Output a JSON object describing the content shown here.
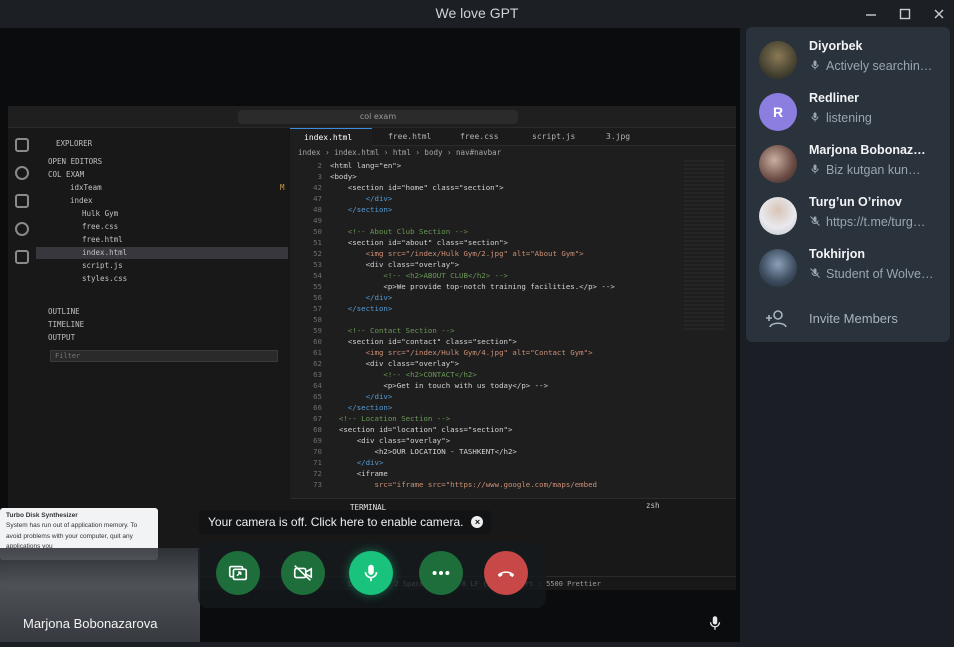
{
  "window": {
    "title": "We love GPT"
  },
  "notice": {
    "camera_off": "Your camera is off. Click here to enable camera."
  },
  "speaker": {
    "name": "Marjona Bobonazarova"
  },
  "controls": [
    {
      "name": "screen-share-button",
      "icon": "screen-share-icon",
      "color": "#1f7a3a"
    },
    {
      "name": "camera-toggle-button",
      "icon": "camera-off-icon",
      "color": "#1f7a3a"
    },
    {
      "name": "microphone-button",
      "icon": "microphone-icon",
      "color": "#19c37d"
    },
    {
      "name": "more-button",
      "icon": "more-icon",
      "color": "#1f7a3a"
    },
    {
      "name": "end-call-button",
      "icon": "phone-hangup-icon",
      "color": "#c84848"
    }
  ],
  "members": [
    {
      "name": "Diyorbek",
      "status": "Actively searchin…",
      "mic": "on"
    },
    {
      "name": "Redliner",
      "status": "listening",
      "mic": "on",
      "initial": "R",
      "avatar_color": "#8c7ee0"
    },
    {
      "name": "Marjona Bobonaz…",
      "status": "Biz kutgan kun…",
      "mic": "on"
    },
    {
      "name": "Turg’un O’rinov",
      "status": "https://t.me/turg…",
      "mic": "off"
    },
    {
      "name": "Tokhirjon",
      "status": "Student of Wolve…",
      "mic": "off"
    }
  ],
  "invite": {
    "label": "Invite Members"
  },
  "shared_screen": {
    "search": "col exam",
    "explorer_title": "EXPLORER",
    "sections": {
      "open_editors": "OPEN EDITORS",
      "project": "COL EXAM",
      "outline": "OUTLINE",
      "timeline": "TIMELINE",
      "output": "OUTPUT"
    },
    "tree": [
      {
        "label": "idxTeam",
        "mark": "M"
      },
      {
        "label": "index"
      },
      {
        "label": "Hulk Gym"
      },
      {
        "label": "free.css"
      },
      {
        "label": "free.html"
      },
      {
        "label": "index.html"
      },
      {
        "label": "script.js"
      },
      {
        "label": "styles.css"
      }
    ],
    "filter_placeholder": "Filter",
    "tabs": [
      "index.html",
      "free.html",
      "free.css",
      "script.js",
      "3.jpg"
    ],
    "breadcrumb": "index › index.html › html › body › nav#navbar",
    "code_lines": [
      {
        "n": "2",
        "t": "<html lang=\"en\">"
      },
      {
        "n": "3",
        "t": "<body>"
      },
      {
        "n": "42",
        "t": "    <section id=\"home\" class=\"section\">"
      },
      {
        "n": "47",
        "t": "        </div>"
      },
      {
        "n": "48",
        "t": "    </section>"
      },
      {
        "n": "49",
        "t": ""
      },
      {
        "n": "50",
        "t": "    <!-- About Club Section -->"
      },
      {
        "n": "51",
        "t": "    <section id=\"about\" class=\"section\">"
      },
      {
        "n": "52",
        "t": "        <img src=\"/index/Hulk Gym/2.jpg\" alt=\"About Gym\">"
      },
      {
        "n": "53",
        "t": "        <div class=\"overlay\">"
      },
      {
        "n": "54",
        "t": "            <!-- <h2>ABOUT CLUB</h2> -->"
      },
      {
        "n": "55",
        "t": "            <p>We provide top-notch training facilities.</p> -->"
      },
      {
        "n": "56",
        "t": "        </div>"
      },
      {
        "n": "57",
        "t": "    </section>"
      },
      {
        "n": "58",
        "t": ""
      },
      {
        "n": "59",
        "t": "    <!-- Contact Section -->"
      },
      {
        "n": "60",
        "t": "    <section id=\"contact\" class=\"section\">"
      },
      {
        "n": "61",
        "t": "        <img src=\"/index/Hulk Gym/4.jpg\" alt=\"Contact Gym\">"
      },
      {
        "n": "62",
        "t": "        <div class=\"overlay\">"
      },
      {
        "n": "63",
        "t": "            <!-- <h2>CONTACT</h2>"
      },
      {
        "n": "64",
        "t": "            <p>Get in touch with us today</p> -->"
      },
      {
        "n": "65",
        "t": "        </div>"
      },
      {
        "n": "66",
        "t": "    </section>"
      },
      {
        "n": "67",
        "t": "  <!-- Location Section -->"
      },
      {
        "n": "68",
        "t": "  <section id=\"location\" class=\"section\">"
      },
      {
        "n": "69",
        "t": "      <div class=\"overlay\">"
      },
      {
        "n": "70",
        "t": "          <h2>OUR LOCATION - TASHKENT</h2>"
      },
      {
        "n": "71",
        "t": "      </div>"
      },
      {
        "n": "72",
        "t": "      <iframe"
      },
      {
        "n": "73",
        "t": "          src=\"iframe src=\"https://www.google.com/maps/embed"
      }
    ],
    "terminal_tab": "TERMINAL",
    "terminal_shell": "zsh",
    "status_items": "Ln 12, Col 2   Spaces: 4   UTF-8   LF   {} HTML   Port : 5500   Prettier",
    "notification_title": "Turbo Disk Synthesizer",
    "notification_text": "System has run out of application memory. To avoid problems with your computer, quit any applications you"
  }
}
